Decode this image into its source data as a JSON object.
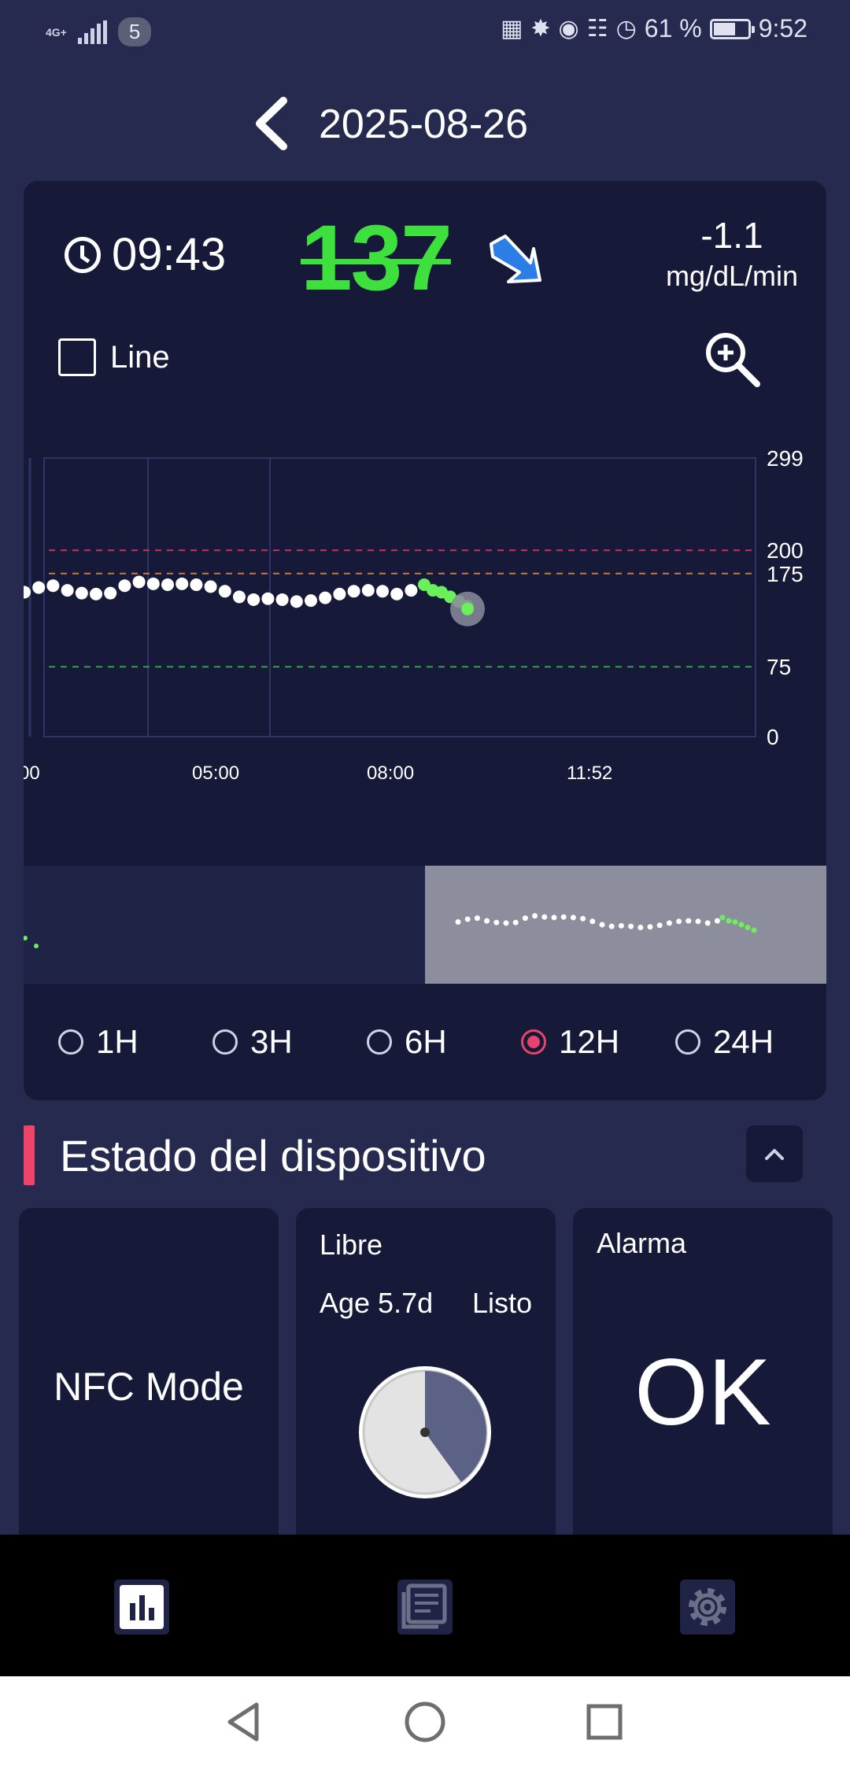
{
  "status_bar": {
    "network": "4G+",
    "badge": "5",
    "battery_percent": "61 %",
    "battery_level": 0.61,
    "time": "9:52",
    "icons": [
      "nfc-icon",
      "bluetooth-icon",
      "location-icon",
      "vibrate-icon",
      "speed-icon",
      "battery-icon"
    ]
  },
  "header": {
    "title": "2025-08-26"
  },
  "reading": {
    "time": "09:43",
    "glucose": "137",
    "glucose_color": "#3ee03e",
    "trend": "falling",
    "rate": "-1.1",
    "rate_unit": "mg/dL/min"
  },
  "chart_controls": {
    "line_label": "Line",
    "line_checked": false
  },
  "chart_data": {
    "type": "scatter",
    "y_ticks": [
      "299",
      "200",
      "175",
      "75",
      "0"
    ],
    "x_ticks": [
      "00",
      "05:00",
      "08:00",
      "11:52"
    ],
    "ylim": [
      0,
      299
    ],
    "thresholds": [
      {
        "value": 200,
        "color": "#c2365f"
      },
      {
        "value": 175,
        "color": "#c27a49"
      },
      {
        "value": 75,
        "color": "#2fa24a"
      }
    ],
    "series": [
      {
        "color": "#ffffff",
        "values": [
          155,
          160,
          162,
          157,
          154,
          153,
          154,
          162,
          166,
          164,
          163,
          164,
          163,
          161,
          156,
          150,
          147,
          148,
          147,
          145,
          146,
          149,
          153,
          156,
          157,
          156,
          153,
          157
        ]
      },
      {
        "color": "#6bef5a",
        "values": [
          163,
          157,
          155,
          150,
          145,
          140
        ]
      }
    ],
    "current_value": 137
  },
  "range_options": [
    {
      "label": "1H",
      "selected": false
    },
    {
      "label": "3H",
      "selected": false
    },
    {
      "label": "6H",
      "selected": false
    },
    {
      "label": "12H",
      "selected": true
    },
    {
      "label": "24H",
      "selected": false
    }
  ],
  "device_status": {
    "title": "Estado del dispositivo",
    "nfc": "NFC Mode",
    "libre": {
      "title": "Libre",
      "age": "Age 5.7d",
      "status": "Listo",
      "progress": 0.4
    },
    "alarm": {
      "title": "Alarma",
      "value": "OK"
    }
  },
  "bottom_nav": {
    "items": [
      "chart-icon",
      "log-icon",
      "settings-icon"
    ],
    "active": "chart-icon"
  }
}
